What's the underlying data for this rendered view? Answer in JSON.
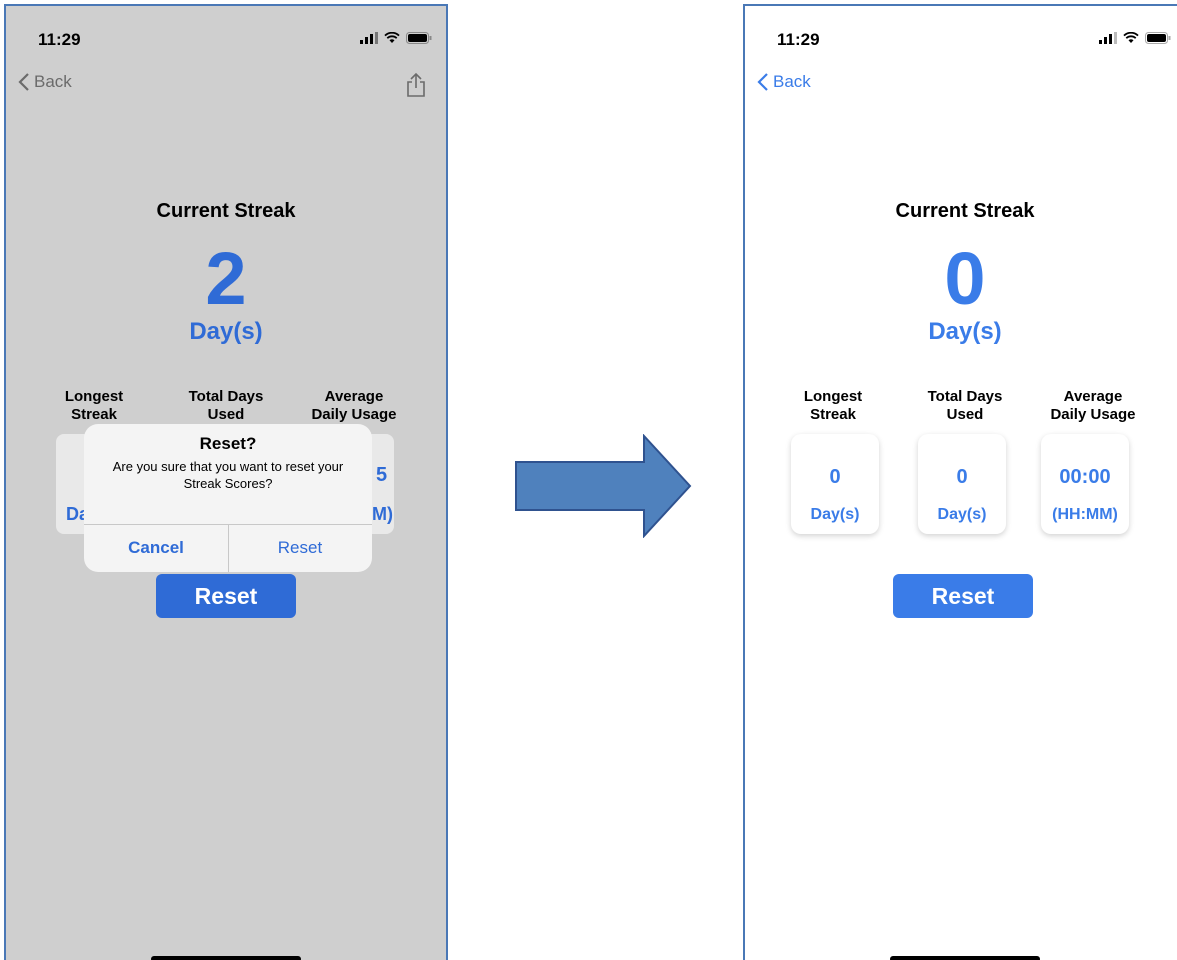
{
  "left_screen": {
    "time": "11:29",
    "back_label": "Back",
    "title": "Current Streak",
    "streak_value": "2",
    "streak_unit": "Day(s)",
    "stats": [
      {
        "heading_line1": "Longest",
        "heading_line2": "Streak"
      },
      {
        "heading_line1": "Total Days",
        "heading_line2": "Used"
      },
      {
        "heading_line1": "Average",
        "heading_line2": "Daily Usage"
      }
    ],
    "partial_left": "Da",
    "partial_right_value": "5",
    "partial_right_unit": "M)",
    "reset_label": "Reset",
    "alert": {
      "title": "Reset?",
      "message": "Are you sure that you want to reset your Streak Scores?",
      "cancel_label": "Cancel",
      "confirm_label": "Reset"
    }
  },
  "right_screen": {
    "time": "11:29",
    "back_label": "Back",
    "title": "Current Streak",
    "streak_value": "0",
    "streak_unit": "Day(s)",
    "stats": [
      {
        "heading_line1": "Longest",
        "heading_line2": "Streak",
        "value": "0",
        "unit": "Day(s)"
      },
      {
        "heading_line1": "Total Days",
        "heading_line2": "Used",
        "value": "0",
        "unit": "Day(s)"
      },
      {
        "heading_line1": "Average",
        "heading_line2": "Daily Usage",
        "value": "00:00",
        "unit": "(HH:MM)"
      }
    ],
    "reset_label": "Reset"
  },
  "colors": {
    "accent": "#3a7ce8",
    "accent_dimmed": "#2f6bd6",
    "arrow": "#4f81bd",
    "dim_overlay": "#cfcfcf"
  }
}
